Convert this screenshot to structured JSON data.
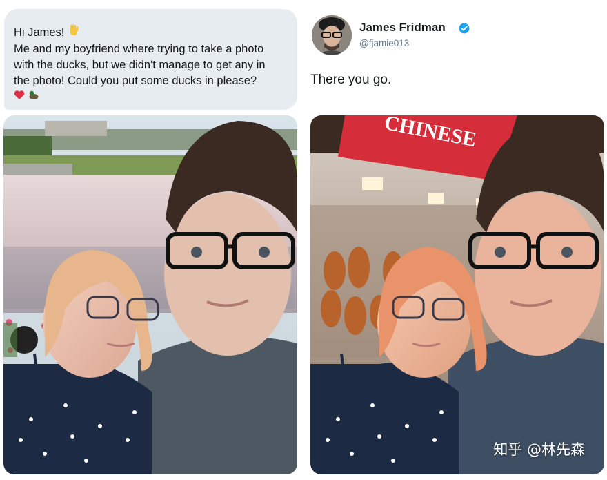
{
  "request": {
    "lines": [
      "Hi James!",
      "Me and my boyfriend where trying to take a photo",
      "with the ducks, but we didn't manage to get any in",
      "the photo! Could you put some ducks in please?"
    ],
    "emojis": [
      "waving-hand",
      "red-heart",
      "duck"
    ]
  },
  "reply": {
    "name": "James Fridman",
    "handle": "@fjamie013",
    "text": "There you go.",
    "verified_color": "#1da1f2"
  },
  "edited_photo": {
    "sign_text": "CHINESE",
    "sign_color": "#d62d3a"
  },
  "watermark": "知乎 @林先森"
}
